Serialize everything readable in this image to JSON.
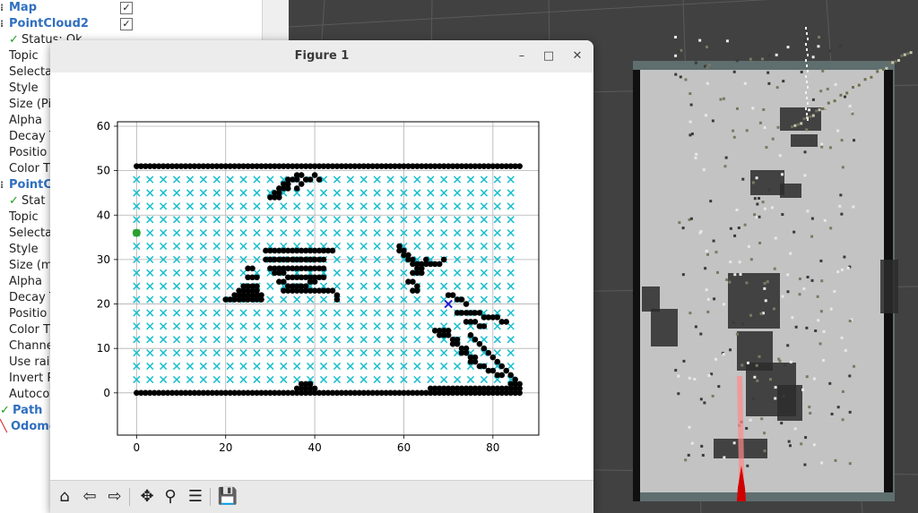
{
  "displays": {
    "rows": [
      {
        "kind": "group",
        "label": "Map",
        "checked": true
      },
      {
        "kind": "group",
        "label": "PointCloud2",
        "checked": true
      },
      {
        "kind": "status",
        "label": "Status: Ok"
      },
      {
        "kind": "prop",
        "label": "Topic"
      },
      {
        "kind": "prop",
        "label": "Selecta"
      },
      {
        "kind": "prop",
        "label": "Style"
      },
      {
        "kind": "prop",
        "label": "Size (Pi"
      },
      {
        "kind": "prop",
        "label": "Alpha"
      },
      {
        "kind": "prop",
        "label": "Decay T"
      },
      {
        "kind": "prop",
        "label": "Positio"
      },
      {
        "kind": "prop",
        "label": "Color T"
      },
      {
        "kind": "group",
        "label": "PointC"
      },
      {
        "kind": "status",
        "label": "Stat"
      },
      {
        "kind": "prop",
        "label": "Topic"
      },
      {
        "kind": "prop",
        "label": "Selecta"
      },
      {
        "kind": "prop",
        "label": "Style"
      },
      {
        "kind": "prop",
        "label": "Size (m"
      },
      {
        "kind": "prop",
        "label": "Alpha"
      },
      {
        "kind": "prop",
        "label": "Decay T"
      },
      {
        "kind": "prop",
        "label": "Positio"
      },
      {
        "kind": "prop",
        "label": "Color T"
      },
      {
        "kind": "prop",
        "label": "Channe"
      },
      {
        "kind": "prop",
        "label": "Use rai"
      },
      {
        "kind": "prop",
        "label": "Invert R"
      },
      {
        "kind": "prop",
        "label": "Autoco"
      },
      {
        "kind": "group-ok",
        "label": "Path"
      },
      {
        "kind": "group-err",
        "label": "Odome"
      }
    ]
  },
  "figure_window": {
    "title": "Figure 1",
    "minimize_glyph": "–",
    "maximize_glyph": "□",
    "close_glyph": "✕"
  },
  "toolbar": [
    {
      "name": "home-icon",
      "glyph": "⌂"
    },
    {
      "name": "back-arrow-icon",
      "glyph": "⇦"
    },
    {
      "name": "forward-arrow-icon",
      "glyph": "⇨"
    },
    {
      "name": "pan-icon",
      "glyph": "✥"
    },
    {
      "name": "zoom-icon",
      "glyph": "⚲"
    },
    {
      "name": "configure-subplots-icon",
      "glyph": "☰"
    },
    {
      "name": "save-icon",
      "glyph": "💾"
    }
  ],
  "chart_data": {
    "type": "scatter",
    "title": "",
    "xlabel": "",
    "ylabel": "",
    "xlim": [
      -4.3,
      90.3
    ],
    "ylim": [
      -9.5,
      61
    ],
    "xticks": [
      0,
      20,
      40,
      60,
      80
    ],
    "yticks": [
      0,
      10,
      20,
      30,
      40,
      50,
      60
    ],
    "grid": true,
    "legend": "none",
    "series": [
      {
        "role": "free-cells",
        "marker": "x",
        "color": "#17becf",
        "grid_x": [
          0,
          3,
          6,
          9,
          12,
          15,
          18,
          21,
          24,
          27,
          30,
          33,
          36,
          39,
          42,
          45,
          48,
          51,
          54,
          57,
          60,
          63,
          66,
          69,
          72,
          75,
          78,
          81,
          84
        ],
        "grid_y": [
          3,
          6,
          9,
          12,
          15,
          18,
          21,
          24,
          27,
          30,
          33,
          36,
          39,
          42,
          45,
          48
        ]
      },
      {
        "role": "obstacles",
        "marker": "o",
        "color": "#000000",
        "segments": [
          {
            "from": [
              0,
              51
            ],
            "to": [
              86,
              51
            ]
          },
          {
            "from": [
              0,
              0
            ],
            "to": [
              86,
              0
            ]
          },
          {
            "from": [
              29,
              32
            ],
            "to": [
              44,
              32
            ]
          },
          {
            "from": [
              29,
              30
            ],
            "to": [
              40,
              30
            ]
          }
        ],
        "clusters": [
          {
            "x": [
              30,
              31,
              31,
              32,
              32,
              33,
              33,
              34,
              34,
              35,
              36,
              36,
              37,
              37,
              38,
              39,
              40,
              41,
              36,
              34,
              32
            ],
            "y": [
              44,
              44,
              45,
              45,
              46,
              46,
              47,
              47,
              48,
              48,
              48,
              49,
              49,
              47,
              48,
              48,
              49,
              48,
              46,
              46,
              44
            ]
          },
          {
            "x": [
              30,
              31,
              32,
              33,
              34,
              35,
              36,
              37,
              38,
              39,
              40,
              41,
              42,
              30,
              31,
              32,
              33,
              34,
              35,
              36,
              37,
              38,
              39,
              40,
              41,
              42,
              31,
              32,
              33,
              34,
              35,
              36,
              37,
              38,
              39,
              40,
              41,
              42,
              32,
              33,
              34,
              35,
              36,
              37,
              38,
              39,
              40,
              33,
              34,
              35,
              36,
              37,
              38,
              39,
              40,
              41,
              42,
              43,
              44,
              45,
              45
            ],
            "y": [
              30,
              30,
              30,
              30,
              30,
              30,
              30,
              30,
              30,
              30,
              30,
              30,
              30,
              28,
              28,
              28,
              28,
              28,
              28,
              28,
              28,
              28,
              28,
              28,
              28,
              28,
              27,
              27,
              27,
              26,
              26,
              26,
              26,
              26,
              26,
              26,
              26,
              26,
              25,
              25,
              24,
              24,
              24,
              24,
              24,
              25,
              25,
              23,
              23,
              23,
              23,
              23,
              23,
              23,
              23,
              23,
              23,
              23,
              23,
              22,
              21
            ]
          },
          {
            "x": [
              20,
              21,
              22,
              23,
              24,
              25,
              26,
              27,
              28,
              22,
              23,
              24,
              25,
              26,
              27,
              28,
              23,
              24,
              25,
              26,
              27,
              24,
              25,
              26,
              27,
              25,
              26,
              27,
              25,
              26
            ],
            "y": [
              21,
              21,
              21,
              21,
              21,
              21,
              21,
              21,
              21,
              22,
              22,
              22,
              22,
              22,
              22,
              22,
              23,
              23,
              23,
              23,
              23,
              24,
              24,
              24,
              24,
              26,
              26,
              26,
              28,
              28
            ]
          },
          {
            "x": [
              59,
              59,
              60,
              60,
              61,
              61,
              62,
              62,
              63,
              63,
              64,
              64,
              65,
              65,
              66,
              67,
              68,
              69,
              62,
              63,
              64,
              61,
              62,
              63,
              62,
              63
            ],
            "y": [
              33,
              32,
              32,
              31,
              31,
              30,
              30,
              29,
              29,
              28,
              28,
              29,
              29,
              30,
              29,
              29,
              29,
              30,
              27,
              27,
              27,
              25,
              25,
              24,
              23,
              23
            ]
          },
          {
            "x": [
              70,
              71,
              72,
              73,
              74,
              72,
              73,
              74,
              75,
              76,
              77,
              78,
              79,
              80,
              81,
              82,
              83,
              74,
              75,
              76,
              77,
              78,
              75,
              76,
              77,
              78,
              79,
              80,
              81,
              82,
              83,
              84,
              85,
              84,
              85,
              86,
              86,
              85,
              84,
              83,
              82,
              81,
              80,
              79,
              78,
              77,
              76,
              75,
              74,
              73,
              72,
              71,
              70,
              69,
              68,
              67,
              66
            ],
            "y": [
              22,
              22,
              21,
              21,
              20,
              18,
              18,
              18,
              18,
              18,
              18,
              17,
              17,
              17,
              17,
              16,
              16,
              16,
              16,
              16,
              15,
              15,
              13,
              12,
              11,
              10,
              9,
              8,
              7,
              6,
              5,
              4,
              3,
              2,
              2,
              2,
              1,
              1,
              1,
              1,
              1,
              1,
              1,
              1,
              1,
              1,
              1,
              1,
              1,
              1,
              1,
              1,
              1,
              1,
              1,
              1,
              1
            ]
          },
          {
            "x": [
              67,
              68,
              69,
              70,
              68,
              69,
              70,
              71,
              72,
              71,
              72,
              73,
              74,
              73,
              74,
              75,
              76,
              75,
              76,
              77,
              78,
              79,
              80,
              81,
              82
            ],
            "y": [
              14,
              14,
              14,
              14,
              13,
              13,
              13,
              12,
              12,
              11,
              11,
              10,
              10,
              9,
              9,
              8,
              8,
              7,
              7,
              6,
              6,
              5,
              5,
              4,
              4
            ]
          },
          {
            "x": [
              36,
              37,
              38,
              39,
              40,
              37,
              38,
              39
            ],
            "y": [
              1,
              1,
              1,
              1,
              1,
              2,
              2,
              2
            ]
          }
        ]
      },
      {
        "role": "start",
        "marker": "o",
        "color": "#2ca02c",
        "x": [
          0
        ],
        "y": [
          36
        ]
      },
      {
        "role": "goal",
        "marker": "x",
        "color": "#1f1fcc",
        "x": [
          70
        ],
        "y": [
          20
        ]
      }
    ]
  }
}
